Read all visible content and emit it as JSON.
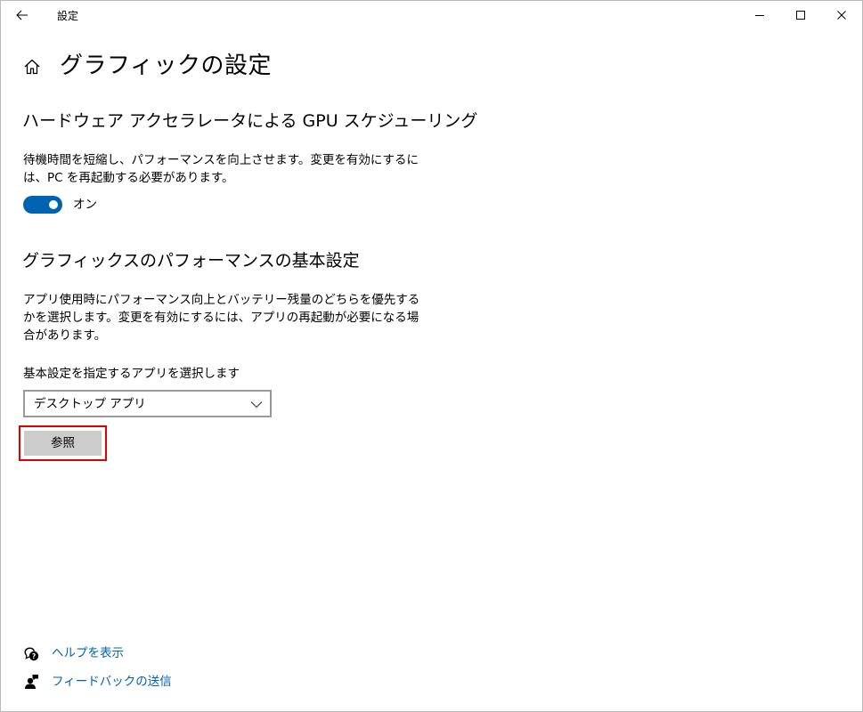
{
  "window": {
    "title": "設定"
  },
  "page": {
    "title": "グラフィックの設定"
  },
  "gpu_scheduling": {
    "heading": "ハードウェア アクセラレータによる GPU スケジューリング",
    "description": "待機時間を短縮し、パフォーマンスを向上させます。変更を有効にするには、PC を再起動する必要があります。",
    "toggle_on": true,
    "toggle_label": "オン"
  },
  "performance": {
    "heading": "グラフィックスのパフォーマンスの基本設定",
    "description": "アプリ使用時にパフォーマンス向上とバッテリー残量のどちらを優先するかを選択します。変更を有効にするには、アプリの再起動が必要になる場合があります。",
    "select_label": "基本設定を指定するアプリを選択します",
    "select_value": "デスクトップ アプリ",
    "browse_label": "参照"
  },
  "footer": {
    "help_label": "ヘルプを表示",
    "feedback_label": "フィードバックの送信"
  },
  "colors": {
    "accent": "#0063b1",
    "highlight_border": "#e00000",
    "button_bg": "#cccccc"
  },
  "icons": {
    "back": "arrow-left-icon",
    "minimize": "minimize-icon",
    "maximize": "maximize-icon",
    "close": "close-icon",
    "home": "home-icon",
    "dropdown": "chevron-down-icon",
    "help": "help-chat-icon",
    "feedback": "feedback-person-icon"
  }
}
